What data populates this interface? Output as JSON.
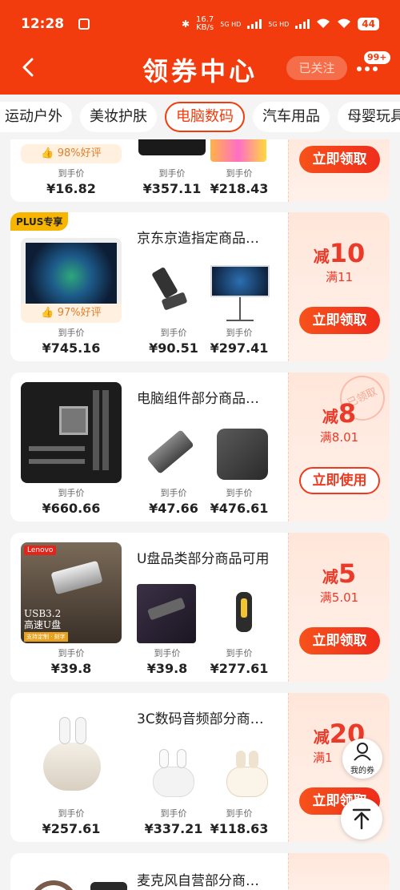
{
  "status_bar": {
    "time": "12:28",
    "speed_value": "16.7",
    "speed_unit": "KB/s",
    "net1": "5G HD",
    "net2": "5G HD",
    "battery": "44"
  },
  "header": {
    "title": "领券中心",
    "follow_label": "已关注",
    "more_badge": "99+"
  },
  "tabs": [
    {
      "label": "运动户外",
      "active": false
    },
    {
      "label": "美妆护肤",
      "active": false
    },
    {
      "label": "电脑数码",
      "active": true
    },
    {
      "label": "汽车用品",
      "active": false
    },
    {
      "label": "母婴玩具",
      "active": false
    }
  ],
  "cards": [
    {
      "rating": "98%好评",
      "prices": [
        {
          "label": "到手价",
          "value": "¥16.82"
        },
        {
          "label": "到手价",
          "value": "¥357.11"
        },
        {
          "label": "到手价",
          "value": "¥218.43"
        }
      ],
      "button": "立即领取"
    },
    {
      "tag": "PLUS专享",
      "title": "京东京造指定商品…",
      "rating": "97%好评",
      "prices": [
        {
          "label": "到手价",
          "value": "¥745.16"
        },
        {
          "label": "到手价",
          "value": "¥90.51"
        },
        {
          "label": "到手价",
          "value": "¥297.41"
        }
      ],
      "discount_pre": "减",
      "discount_num": "10",
      "threshold": "满11",
      "button": "立即领取"
    },
    {
      "title": "电脑组件部分商品…",
      "prices": [
        {
          "label": "到手价",
          "value": "¥660.66"
        },
        {
          "label": "到手价",
          "value": "¥47.66"
        },
        {
          "label": "到手价",
          "value": "¥476.61"
        }
      ],
      "discount_pre": "减",
      "discount_num": "8",
      "threshold": "满8.01",
      "stamp": "已领取",
      "button": "立即使用"
    },
    {
      "title": "U盘品类部分商品可用",
      "brand": "Lenovo",
      "img_text1": "USB3.2",
      "img_text2": "高速U盘",
      "img_text3": "支持定制 · 刻字",
      "prices": [
        {
          "label": "到手价",
          "value": "¥39.8"
        },
        {
          "label": "到手价",
          "value": "¥39.8"
        },
        {
          "label": "到手价",
          "value": "¥277.61"
        }
      ],
      "discount_pre": "减",
      "discount_num": "5",
      "threshold": "满5.01",
      "button": "立即领取"
    },
    {
      "title": "3C数码音频部分商…",
      "prices": [
        {
          "label": "到手价",
          "value": "¥257.61"
        },
        {
          "label": "到手价",
          "value": "¥337.21"
        },
        {
          "label": "到手价",
          "value": "¥118.63"
        }
      ],
      "discount_pre": "减",
      "discount_num": "20",
      "threshold": "满1",
      "button": "立即领取"
    },
    {
      "title": "麦克风自营部分商…"
    }
  ],
  "floating": {
    "my_coupons": "我的券"
  }
}
